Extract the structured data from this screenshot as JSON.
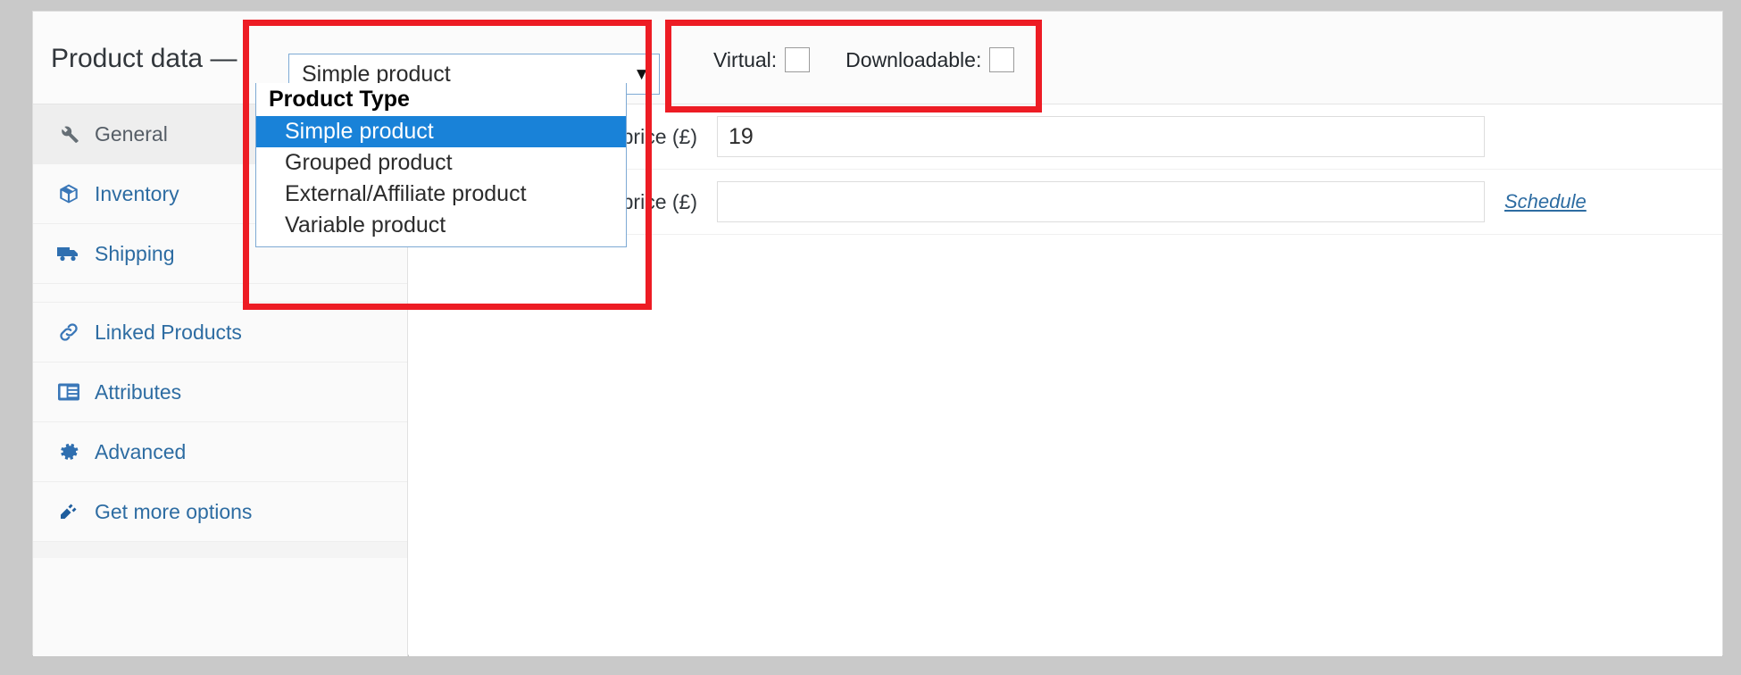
{
  "header": {
    "title": "Product data —"
  },
  "product_type_select": {
    "value": "Simple product",
    "arrow_icon": "chevron-down-icon",
    "optgroup_label": "Product Type",
    "options": [
      {
        "label": "Simple product",
        "selected": true
      },
      {
        "label": "Grouped product",
        "selected": false
      },
      {
        "label": "External/Affiliate product",
        "selected": false
      },
      {
        "label": "Variable product",
        "selected": false
      }
    ]
  },
  "checkboxes": [
    {
      "label": "Virtual:",
      "checked": false
    },
    {
      "label": "Downloadable:",
      "checked": false
    }
  ],
  "tabs": [
    {
      "label": "General",
      "icon": "wrench-icon",
      "active": true
    },
    {
      "label": "Inventory",
      "icon": "box-icon",
      "active": false
    },
    {
      "label": "Shipping",
      "icon": "truck-icon",
      "active": false
    },
    {
      "label": "Linked Products",
      "icon": "link-icon",
      "active": false
    },
    {
      "label": "Attributes",
      "icon": "attributes-icon",
      "active": false
    },
    {
      "label": "Advanced",
      "icon": "gear-icon",
      "active": false
    },
    {
      "label": "Get more options",
      "icon": "plug-icon",
      "active": false
    }
  ],
  "general_fields": [
    {
      "label": "Regular price (£)",
      "value": "19",
      "placeholder": "",
      "has_schedule": false
    },
    {
      "label": "Sale price (£)",
      "value": "",
      "placeholder": "",
      "has_schedule": true,
      "schedule_label": "Schedule"
    }
  ],
  "colors": {
    "accent_blue": "#1982d8",
    "link_blue": "#2d6ca2",
    "annotation_red": "#ed1c24",
    "panel_bg": "#ffffff",
    "page_bg": "#c9c9c9"
  }
}
